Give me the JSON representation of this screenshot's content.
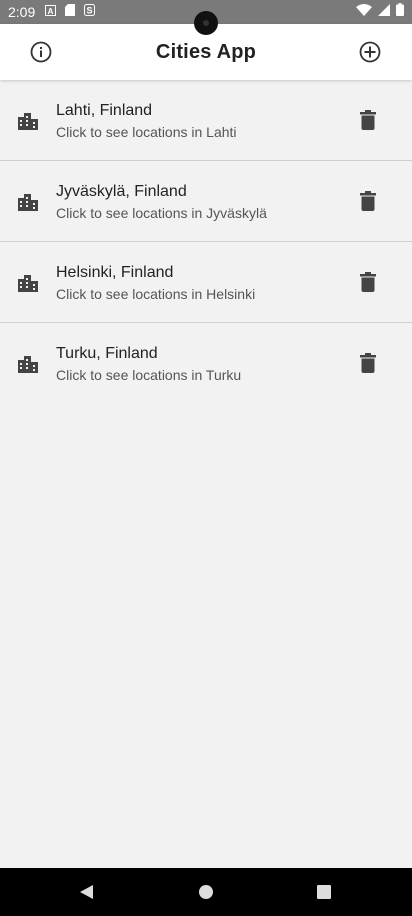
{
  "status_bar": {
    "time": "2:09",
    "icons_left": [
      "font-a-icon",
      "sd-card-icon",
      "s-notification-icon"
    ],
    "icons_right": [
      "wifi-icon",
      "signal-icon",
      "battery-icon"
    ]
  },
  "app_bar": {
    "title": "Cities App",
    "left_icon": "info-icon",
    "right_icon": "add-circle-icon"
  },
  "cities": [
    {
      "name": "Lahti, Finland",
      "subtitle": "Click to see locations in Lahti"
    },
    {
      "name": "Jyväskylä, Finland",
      "subtitle": "Click to see locations in Jyväskylä"
    },
    {
      "name": "Helsinki, Finland",
      "subtitle": "Click to see locations in Helsinki"
    },
    {
      "name": "Turku, Finland",
      "subtitle": "Click to see locations in Turku"
    }
  ],
  "colors": {
    "background": "#f2f2f2",
    "app_bar": "#ffffff",
    "icon": "#444444",
    "divider": "#cfcfcf",
    "status_bar": "#7a7a7a",
    "nav_bar": "#000000"
  }
}
